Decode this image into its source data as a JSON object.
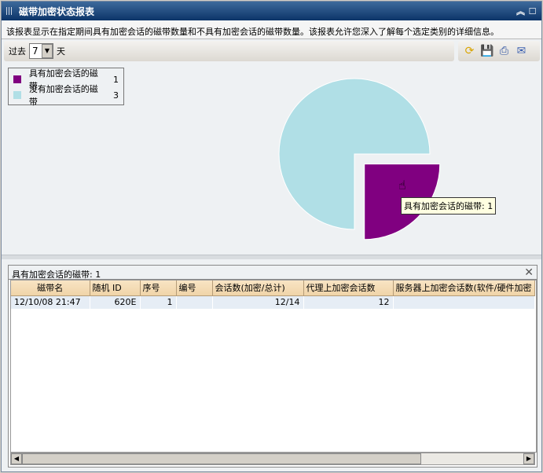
{
  "window": {
    "title": "磁带加密状态报表",
    "collapse_icon": "double-chevron-up-icon",
    "maximize_icon": "square-icon"
  },
  "description": "该报表显示在指定期间具有加密会话的磁带数量和不具有加密会话的磁带数量。该报表允许您深入了解每个选定类别的详细信息。",
  "toolbar": {
    "prefix": "过去",
    "days_value": "7",
    "suffix": "天",
    "icons": [
      "refresh-icon",
      "save-icon",
      "print-icon",
      "email-icon"
    ]
  },
  "chart_data": {
    "type": "pie",
    "series": [
      {
        "name": "具有加密会话的磁带",
        "value": 1,
        "color": "#800080",
        "exploded": true
      },
      {
        "name": "没有加密会话的磁带",
        "value": 3,
        "color": "#b0dfe6"
      }
    ],
    "legend": "top-left",
    "tooltip": "具有加密会话的磁带: 1"
  },
  "detail": {
    "title": "具有加密会话的磁带: 1",
    "columns": [
      "磁带名",
      "随机 ID",
      "序号",
      "编号",
      "会话数(加密/总计)",
      "代理上加密会话数",
      "服务器上加密会话数(软件/硬件加密"
    ],
    "rows": [
      [
        "12/10/08 21:47",
        "620E",
        "1",
        "",
        "12/14",
        "12",
        ""
      ]
    ]
  }
}
